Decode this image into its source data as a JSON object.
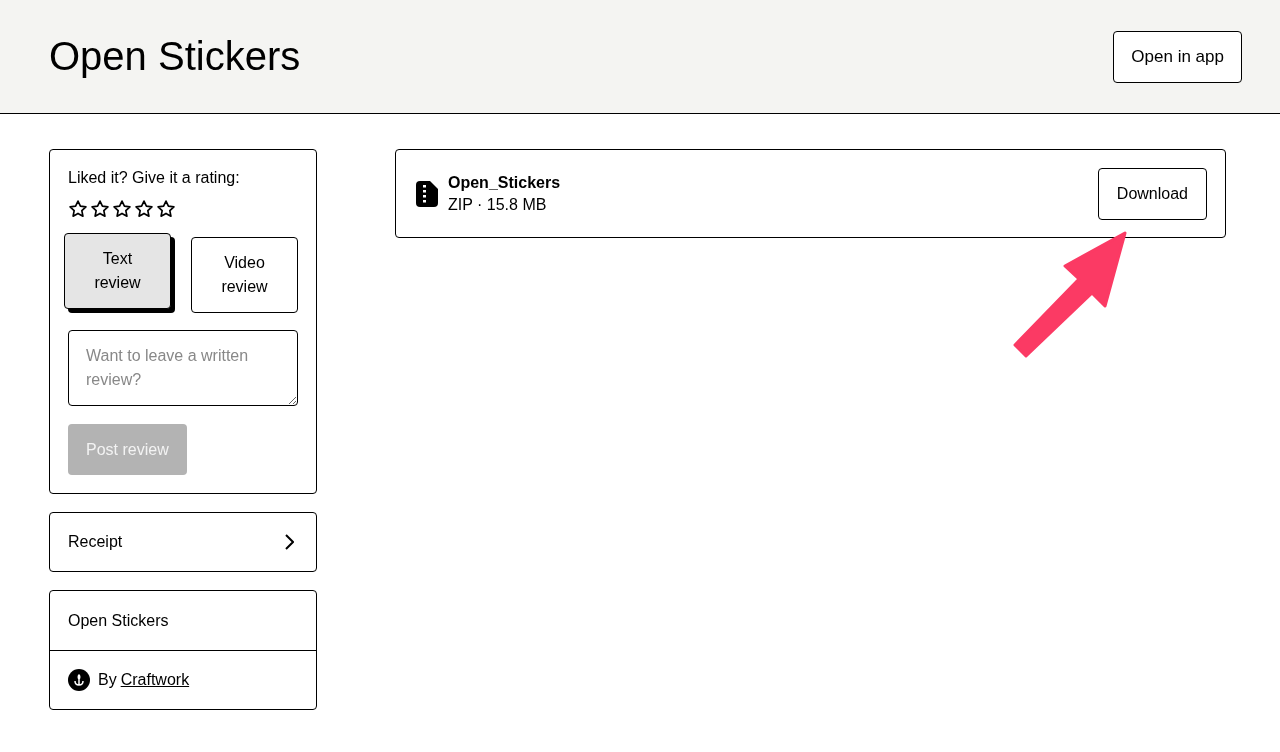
{
  "header": {
    "title": "Open Stickers",
    "open_button": "Open in app"
  },
  "rating": {
    "prompt": "Liked it? Give it a rating:",
    "stars": 0
  },
  "review_tabs": [
    {
      "label": "Text review",
      "selected": true
    },
    {
      "label": "Video review",
      "selected": false
    }
  ],
  "review_field": {
    "placeholder": "Want to leave a written review?"
  },
  "post_button": {
    "label": "Post review",
    "disabled": true
  },
  "receipt": {
    "label": "Receipt"
  },
  "product": {
    "name": "Open Stickers",
    "by": "By",
    "creator": "Craftwork"
  },
  "file": {
    "name": "Open_Stickers",
    "meta": "ZIP · 15.8 MB",
    "button": "Download"
  }
}
